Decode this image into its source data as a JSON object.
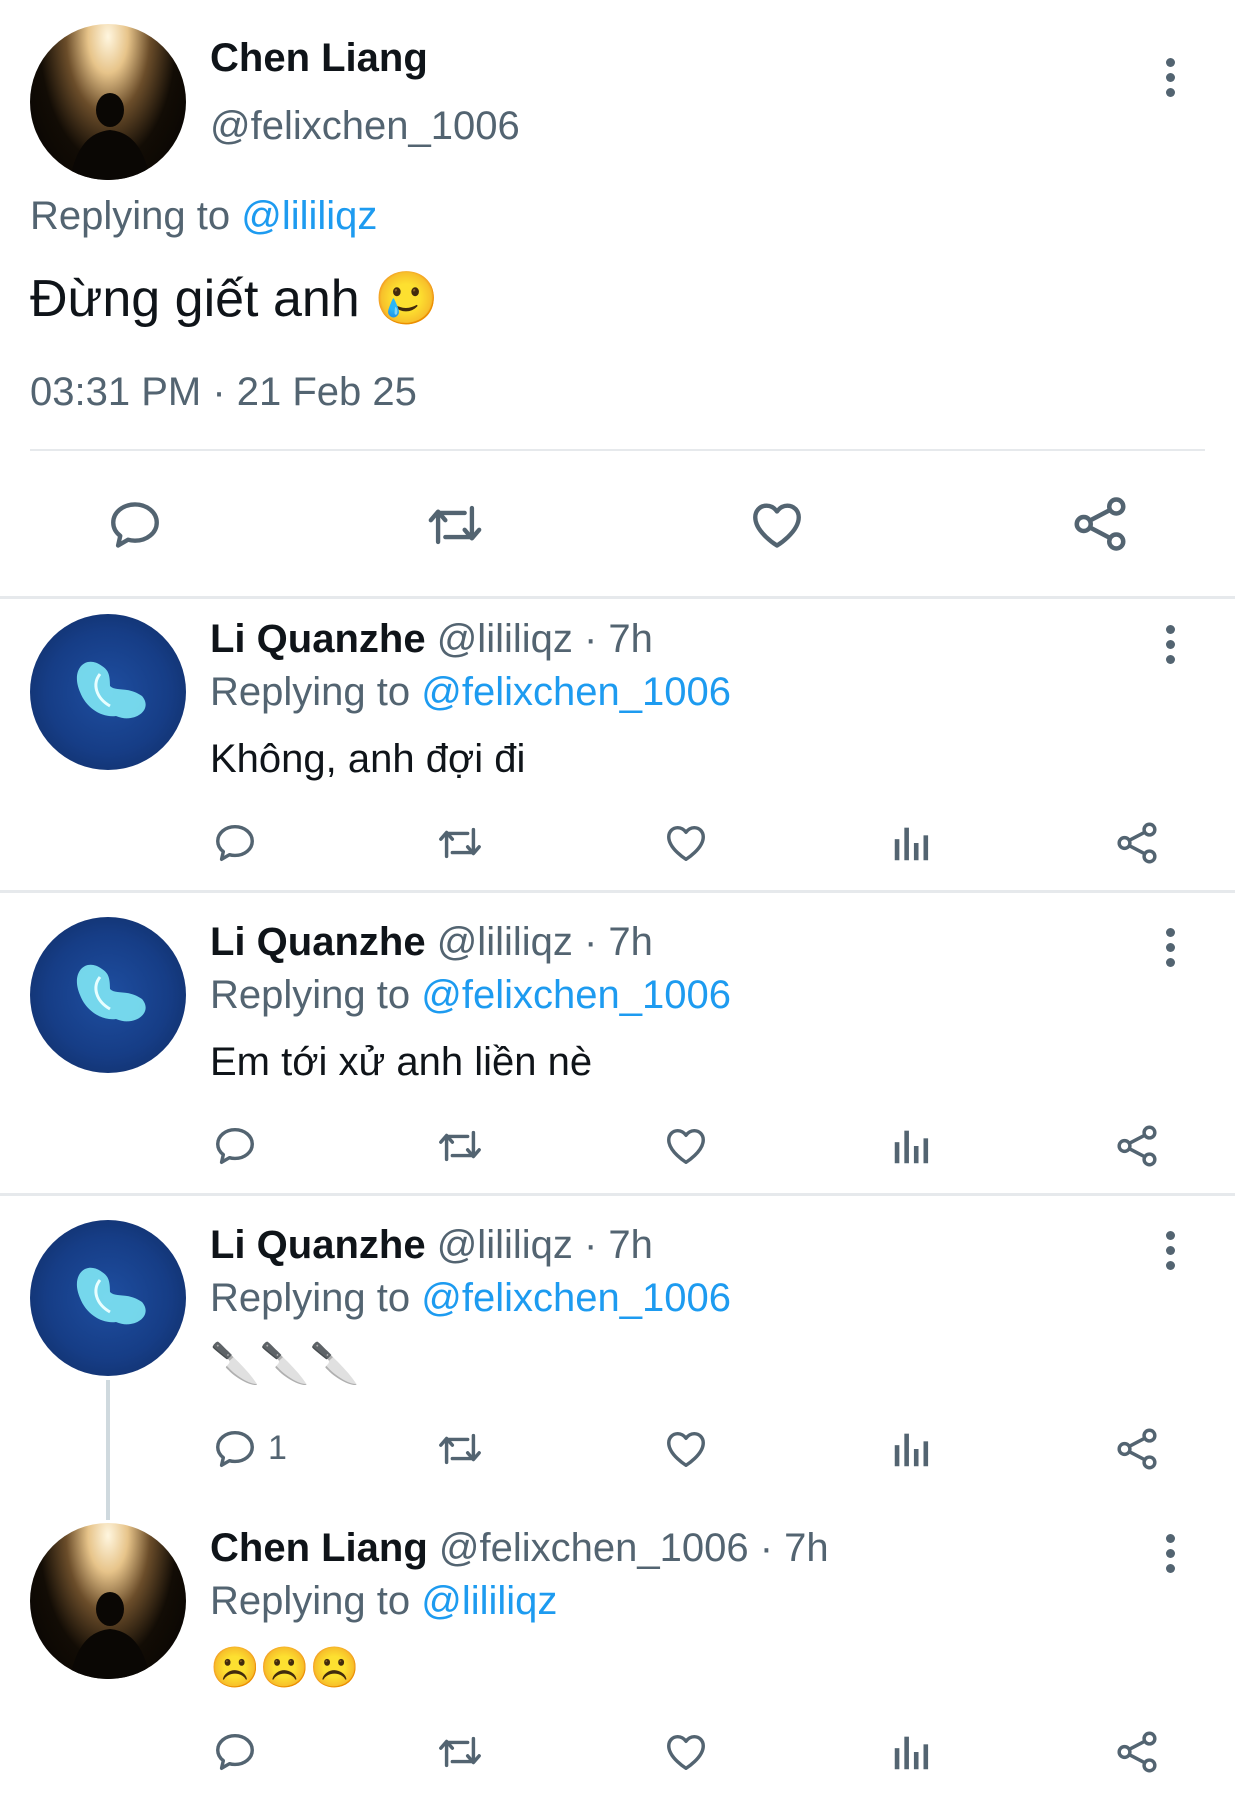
{
  "main_tweet": {
    "name": "Chen Liang",
    "handle": "@felixchen_1006",
    "replying_label": "Replying to ",
    "replying_handle": "@lililiqz",
    "text": "Đừng giết anh 🥲",
    "timestamp": "03:31 PM · 21 Feb 25"
  },
  "replies": [
    {
      "name": "Li Quanzhe",
      "handle": "@lililiqz",
      "time": "· 7h",
      "replying_label": "Replying to ",
      "replying_handle": "@felixchen_1006",
      "text": "Không, anh đợi đi"
    },
    {
      "name": "Li Quanzhe",
      "handle": "@lililiqz",
      "time": "· 7h",
      "replying_label": "Replying to ",
      "replying_handle": "@felixchen_1006",
      "text": "Em tới xử anh liền nè"
    },
    {
      "name": "Li Quanzhe",
      "handle": "@lililiqz",
      "time": "· 7h",
      "replying_label": "Replying to ",
      "replying_handle": "@felixchen_1006",
      "text": "🔪🔪🔪",
      "reply_count": "1"
    },
    {
      "name": "Chen Liang",
      "handle": "@felixchen_1006",
      "time": "· 7h",
      "replying_label": "Replying to ",
      "replying_handle": "@lililiqz",
      "text": "☹️☹️☹️"
    }
  ],
  "icons": {
    "reply": "speech-bubble-icon",
    "retweet": "retweet-icon",
    "like": "heart-icon",
    "views": "bar-chart-icon",
    "share": "share-icon",
    "more": "more-vertical-icon"
  },
  "colors": {
    "link": "#1d9bf0",
    "muted": "#536471",
    "text": "#0f1419",
    "divider": "#e6e9ec"
  }
}
